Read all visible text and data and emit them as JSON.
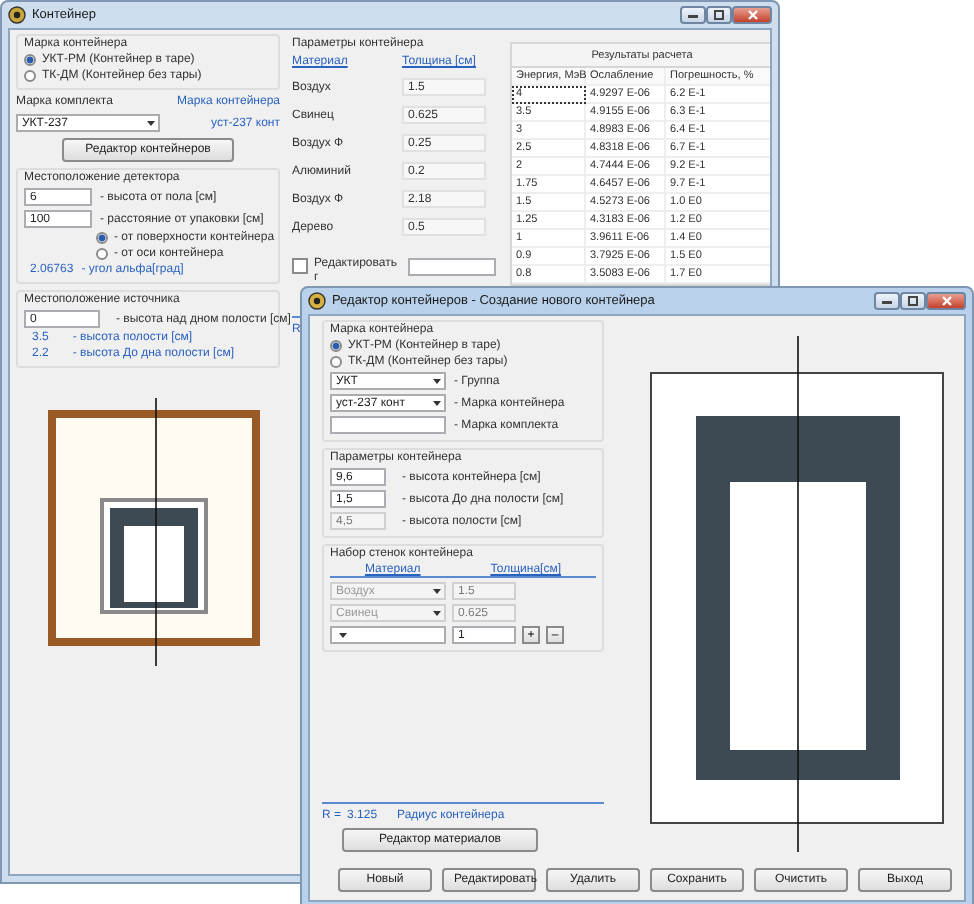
{
  "main_window": {
    "title": "Контейнер",
    "container_brand": {
      "title": "Марка контейнера",
      "options": [
        {
          "label": "УКТ-РМ (Контейнер в таре)",
          "selected": true
        },
        {
          "label": "ТК-ДМ (Контейнер без тары)",
          "selected": false
        }
      ]
    },
    "kit": {
      "label": "Марка комплекта",
      "value": "УКТ-237",
      "container_label": "Марка контейнера",
      "container_value": "уст-237 конт"
    },
    "editor_button": "Редактор контейнеров",
    "detector": {
      "title": "Местоположение детектора",
      "fields": [
        {
          "value": "6",
          "label": "- высота от пола [см]"
        },
        {
          "value": "100",
          "label": "- расстояние от упаковки [см]"
        }
      ],
      "options": [
        {
          "label": "- от поверхности контейнера",
          "selected": true
        },
        {
          "label": "- от оси контейнера",
          "selected": false
        }
      ],
      "angle_value": "2.06763",
      "angle_label": "- угол альфа[град]"
    },
    "source": {
      "title": "Местоположение источника",
      "field": {
        "value": "0",
        "label": "- высота над дном полости [см]"
      },
      "readings": [
        {
          "value": "3.5",
          "label": "- высота полости [см]"
        },
        {
          "value": "2.2",
          "label": "- высота До дна полости [см]"
        }
      ]
    },
    "params": {
      "title": "Параметры контейнера",
      "columns": [
        "Материал",
        "Толщина [см]"
      ],
      "rows": [
        [
          "Воздух",
          "1.5"
        ],
        [
          "Свинец",
          "0.625"
        ],
        [
          "Воздух Ф",
          "0.25"
        ],
        [
          "Алюминий",
          "0.2"
        ],
        [
          "Воздух Ф",
          "2.18"
        ],
        [
          "Дерево",
          "0.5"
        ]
      ]
    },
    "edit_checkbox": {
      "label": "Редактировать г",
      "checked": false
    },
    "r_label": "R",
    "results": {
      "title": "Результаты расчета",
      "columns": [
        "Энергия, МэВ",
        "Ослабление",
        "Погрешность, %"
      ],
      "rows": [
        {
          "cells": [
            "4",
            "4.9297 E-06",
            "6.2 E-1"
          ],
          "selected": true
        },
        {
          "cells": [
            "3.5",
            "4.9155 E-06",
            "6.3 E-1"
          ],
          "selected": false
        },
        {
          "cells": [
            "3",
            "4.8983 E-06",
            "6.4 E-1"
          ],
          "selected": false
        },
        {
          "cells": [
            "2.5",
            "4.8318 E-06",
            "6.7 E-1"
          ],
          "selected": false
        },
        {
          "cells": [
            "2",
            "4.7444 E-06",
            "9.2 E-1"
          ],
          "selected": false
        },
        {
          "cells": [
            "1.75",
            "4.6457 E-06",
            "9.7 E-1"
          ],
          "selected": false
        },
        {
          "cells": [
            "1.5",
            "4.5273 E-06",
            "1.0 E0"
          ],
          "selected": false
        },
        {
          "cells": [
            "1.25",
            "4.3183 E-06",
            "1.2 E0"
          ],
          "selected": false
        },
        {
          "cells": [
            "1",
            "3.9611 E-06",
            "1.4 E0"
          ],
          "selected": false
        },
        {
          "cells": [
            "0.9",
            "3.7925 E-06",
            "1.5 E0"
          ],
          "selected": false
        },
        {
          "cells": [
            "0.8",
            "3.5083 E-06",
            "1.7 E0"
          ],
          "selected": false
        }
      ]
    }
  },
  "editor_window": {
    "title": "Редактор контейнеров - Создание нового контейнера",
    "container_brand": {
      "title": "Марка контейнера",
      "options": [
        {
          "label": "УКТ-РМ (Контейнер в таре)",
          "selected": true
        },
        {
          "label": "ТК-ДМ (Контейнер без тары)",
          "selected": false
        }
      ]
    },
    "group": {
      "value": "УКТ",
      "label": "- Группа"
    },
    "brand": {
      "value": "уст-237 конт",
      "label": "- Марка контейнера"
    },
    "kit": {
      "label": "- Марка комплекта"
    },
    "params": {
      "title": "Параметры контейнера",
      "fields": [
        {
          "value": "9,6",
          "label": "- высота контейнера [см]",
          "disabled": false
        },
        {
          "value": "1,5",
          "label": "- высота До дна полости [см]",
          "disabled": false
        },
        {
          "value": "4,5",
          "label": "- высота полости [см]",
          "disabled": true
        }
      ]
    },
    "walls": {
      "title": "Набор стенок контейнера",
      "columns": [
        "Материал",
        "Толщина[см]"
      ],
      "rows": [
        {
          "material": "Воздух",
          "thickness": "1.5",
          "disabled": true
        },
        {
          "material": "Свинец",
          "thickness": "0.625",
          "disabled": true
        },
        {
          "thickness": "1",
          "disabled": false
        }
      ],
      "add_button": "+",
      "remove_button": "–"
    },
    "radius": {
      "prefix": "R =",
      "value": "3.125",
      "label": "Радиус контейнера"
    },
    "materials_button": "Редактор материалов",
    "buttons": [
      "Новый",
      "Редактировать",
      "Удалить",
      "Сохранить",
      "Очистить",
      "Выход"
    ]
  }
}
